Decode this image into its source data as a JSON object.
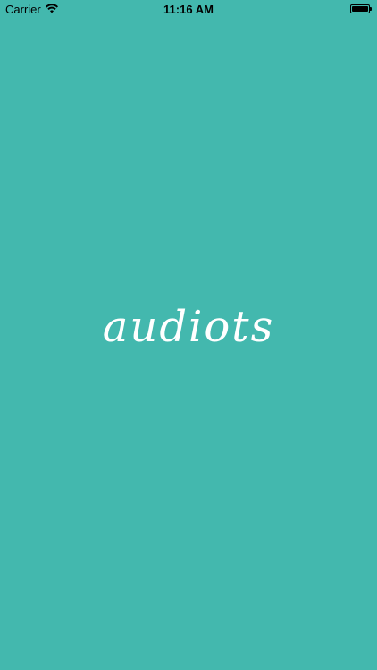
{
  "status_bar": {
    "carrier": "Carrier",
    "time": "11:16 AM",
    "wifi_icon": "wifi-icon",
    "battery_icon": "battery-icon",
    "battery_level": 1.0
  },
  "splash": {
    "logo_text": "audiots",
    "background_color": "#43b8ae",
    "logo_color": "#ffffff"
  }
}
